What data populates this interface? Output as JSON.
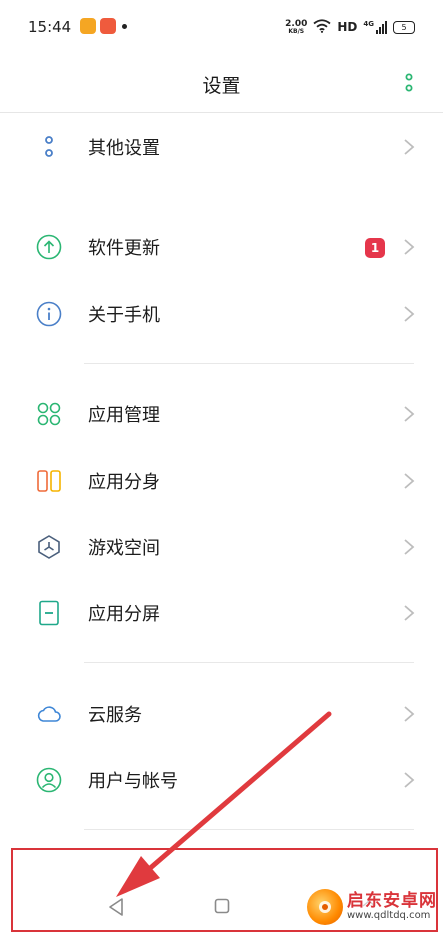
{
  "status_bar": {
    "time": "15:44",
    "net_speed_value": "2.00",
    "net_speed_unit": "KB/S",
    "hd": "HD",
    "network": "4G",
    "battery": "5",
    "app_icon_colors": [
      "#f5a623",
      "#ef5b3d"
    ]
  },
  "header": {
    "title": "设置"
  },
  "sections": [
    {
      "items": [
        {
          "label": "其他设置",
          "icon": "dots-vertical-icon"
        }
      ]
    },
    {
      "items": [
        {
          "label": "软件更新",
          "icon": "upload-icon",
          "badge": "1"
        },
        {
          "label": "关于手机",
          "icon": "info-icon"
        }
      ]
    },
    {
      "items": [
        {
          "label": "应用管理",
          "icon": "apps-grid-icon"
        },
        {
          "label": "应用分身",
          "icon": "app-clone-icon"
        },
        {
          "label": "游戏空间",
          "icon": "game-space-icon"
        },
        {
          "label": "应用分屏",
          "icon": "split-screen-icon"
        }
      ]
    },
    {
      "items": [
        {
          "label": "云服务",
          "icon": "cloud-icon"
        },
        {
          "label": "用户与帐号",
          "icon": "user-account-icon"
        }
      ]
    }
  ],
  "nav": {
    "back": "back-icon",
    "home": "home-icon",
    "recent": "recent-apps-icon"
  },
  "colors": {
    "accent_green": "#2bb673",
    "accent_blue": "#4a7fc8",
    "annotation_red": "#d9343a",
    "badge_red": "#e5364b"
  },
  "watermark": {
    "name": "启东安卓网",
    "url": "www.qdltdq.com"
  }
}
